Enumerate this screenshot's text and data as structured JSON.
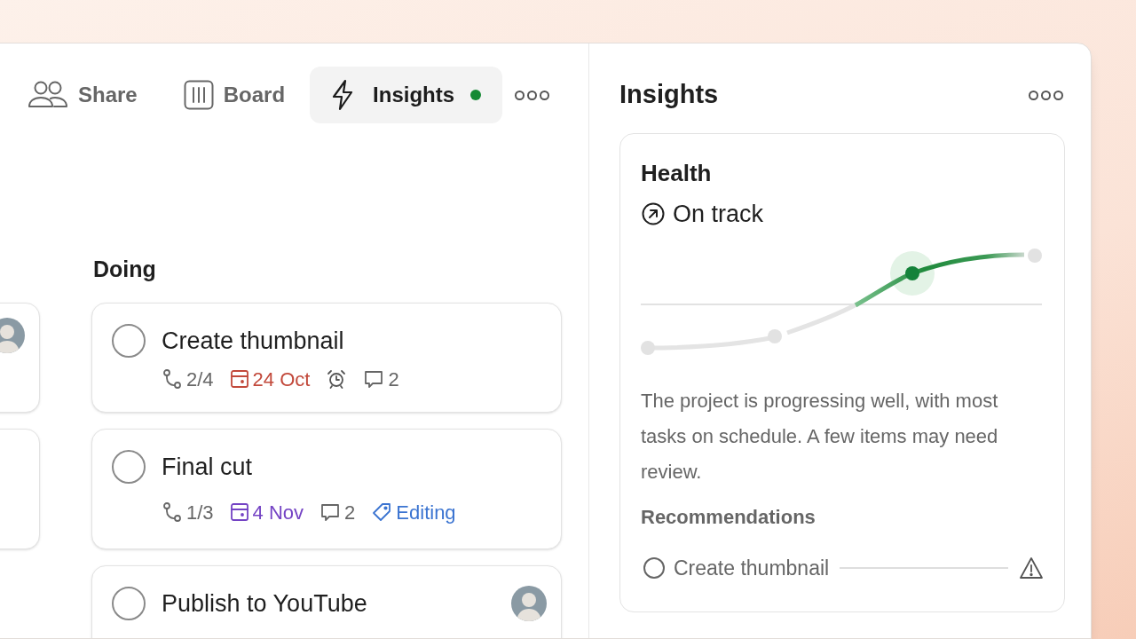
{
  "toolbar": {
    "tabs": [
      {
        "kind": "share",
        "label": "Share",
        "selected": false,
        "unread": false
      },
      {
        "kind": "board",
        "label": "Board",
        "selected": false,
        "unread": false
      },
      {
        "kind": "insights",
        "label": "Insights",
        "selected": true,
        "unread": true
      }
    ]
  },
  "previous_column": {
    "cards": [
      {
        "avatar": true
      },
      {
        "avatar": false
      }
    ]
  },
  "doing_column": {
    "title": "Doing",
    "cards": [
      {
        "title": "Create thumbnail",
        "checked": false,
        "avatar": false,
        "meta": [
          {
            "kind": "subtasks",
            "text": "2/4"
          },
          {
            "kind": "date",
            "text": "24 Oct",
            "color": "#c2493b"
          },
          {
            "kind": "reminder"
          },
          {
            "kind": "comments",
            "text": "2"
          }
        ]
      },
      {
        "title": "Final cut",
        "checked": false,
        "avatar": false,
        "meta": [
          {
            "kind": "subtasks",
            "text": "1/3"
          },
          {
            "kind": "date",
            "text": "4 Nov",
            "color": "#7443c4"
          },
          {
            "kind": "comments",
            "text": "2"
          },
          {
            "kind": "label",
            "text": "Editing",
            "color": "#3b74d1"
          }
        ]
      },
      {
        "title": "Publish to YouTube",
        "checked": false,
        "avatar": true
      }
    ]
  },
  "insights_panel": {
    "title": "Insights",
    "health": {
      "title": "Health",
      "status": "On track"
    },
    "summary": "The project is progressing well, with most tasks on schedule. A few items may need review.",
    "recommendations": {
      "heading": "Recommendations",
      "items": [
        {
          "label": "Create thumbnail",
          "checked": false,
          "warning": true
        }
      ]
    }
  }
}
